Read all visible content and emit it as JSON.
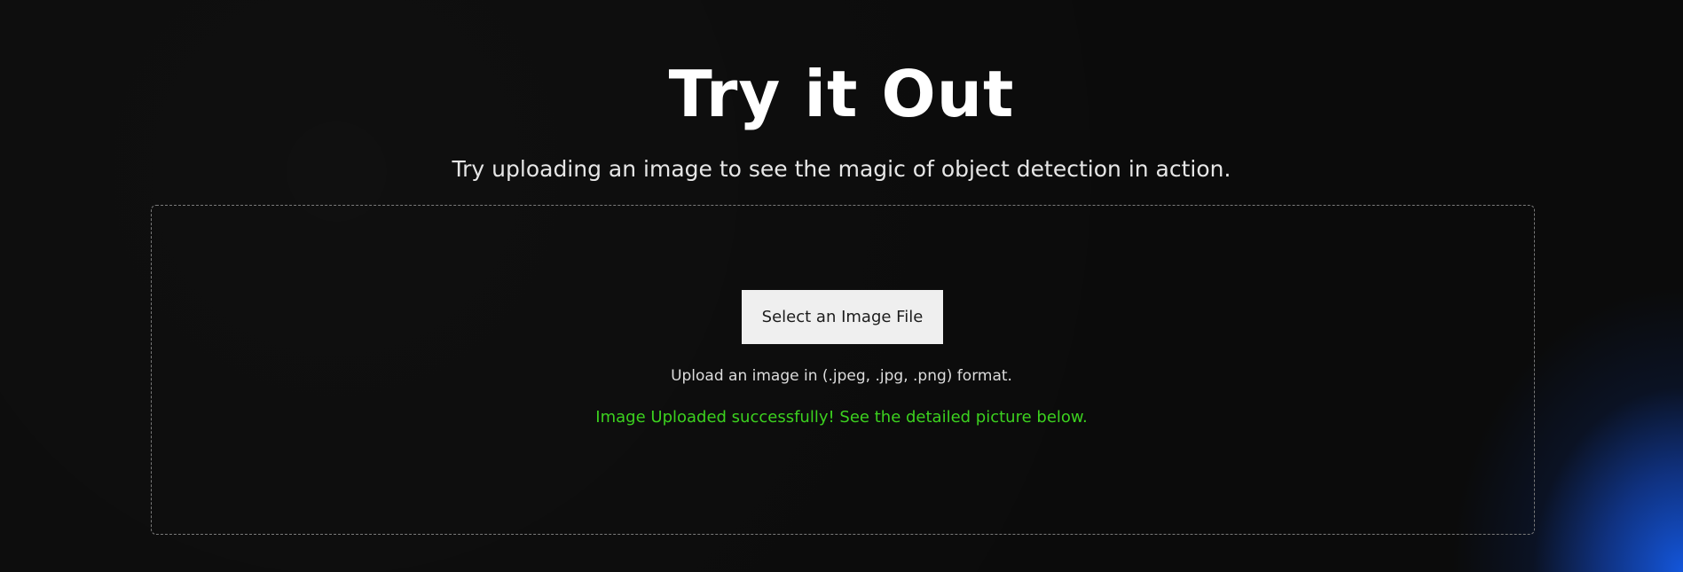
{
  "section": {
    "title": "Try it Out",
    "subtitle": "Try uploading an image to see the magic of object detection in action."
  },
  "upload": {
    "button_label": "Select an Image File",
    "format_hint": "Upload an image in (.jpeg, .jpg, .png) format.",
    "status_message": "Image Uploaded successfully! See the detailed picture below."
  },
  "colors": {
    "background": "#0b0b0b",
    "accent_glow": "#1450e0",
    "success": "#3cd11f",
    "button_bg": "#efefef"
  }
}
